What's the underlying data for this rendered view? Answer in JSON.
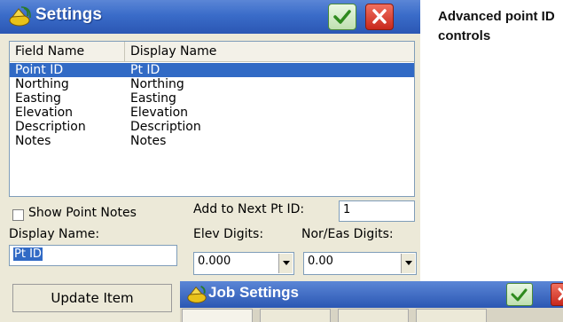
{
  "window": {
    "title": "Settings",
    "icon": "satellite-icon",
    "ok_icon": "checkmark-icon",
    "close_icon": "close-icon"
  },
  "fields": {
    "col_field": "Field Name",
    "col_display": "Display Name",
    "rows": [
      {
        "field": "Point ID",
        "display": "Pt ID",
        "selected": true
      },
      {
        "field": "Northing",
        "display": "Northing"
      },
      {
        "field": "Easting",
        "display": "Easting"
      },
      {
        "field": "Elevation",
        "display": "Elevation"
      },
      {
        "field": "Description",
        "display": "Description"
      },
      {
        "field": "Notes",
        "display": "Notes"
      }
    ]
  },
  "options": {
    "show_notes_label": "Show Point Notes",
    "show_notes_checked": false,
    "add_next_label": "Add to Next Pt ID:",
    "add_next_value": "1",
    "display_name_label": "Display Name:",
    "display_name_value": "Pt ID",
    "elev_label": "Elev Digits:",
    "elev_value": "0.000",
    "nor_eas_label": "Nor/Eas Digits:",
    "nor_eas_value": "0.00"
  },
  "update_button": "Update Item",
  "job_window": {
    "title": "Job Settings",
    "icon": "satellite-icon",
    "ok_icon": "checkmark-icon",
    "close_icon": "close-icon"
  },
  "caption": "Advanced point ID controls",
  "colors": {
    "titlebar": "#2b57b3",
    "selection": "#316ac5",
    "ok_green": "#4a8a3a",
    "close_red": "#c8281c",
    "window_bg": "#ece9d8"
  }
}
